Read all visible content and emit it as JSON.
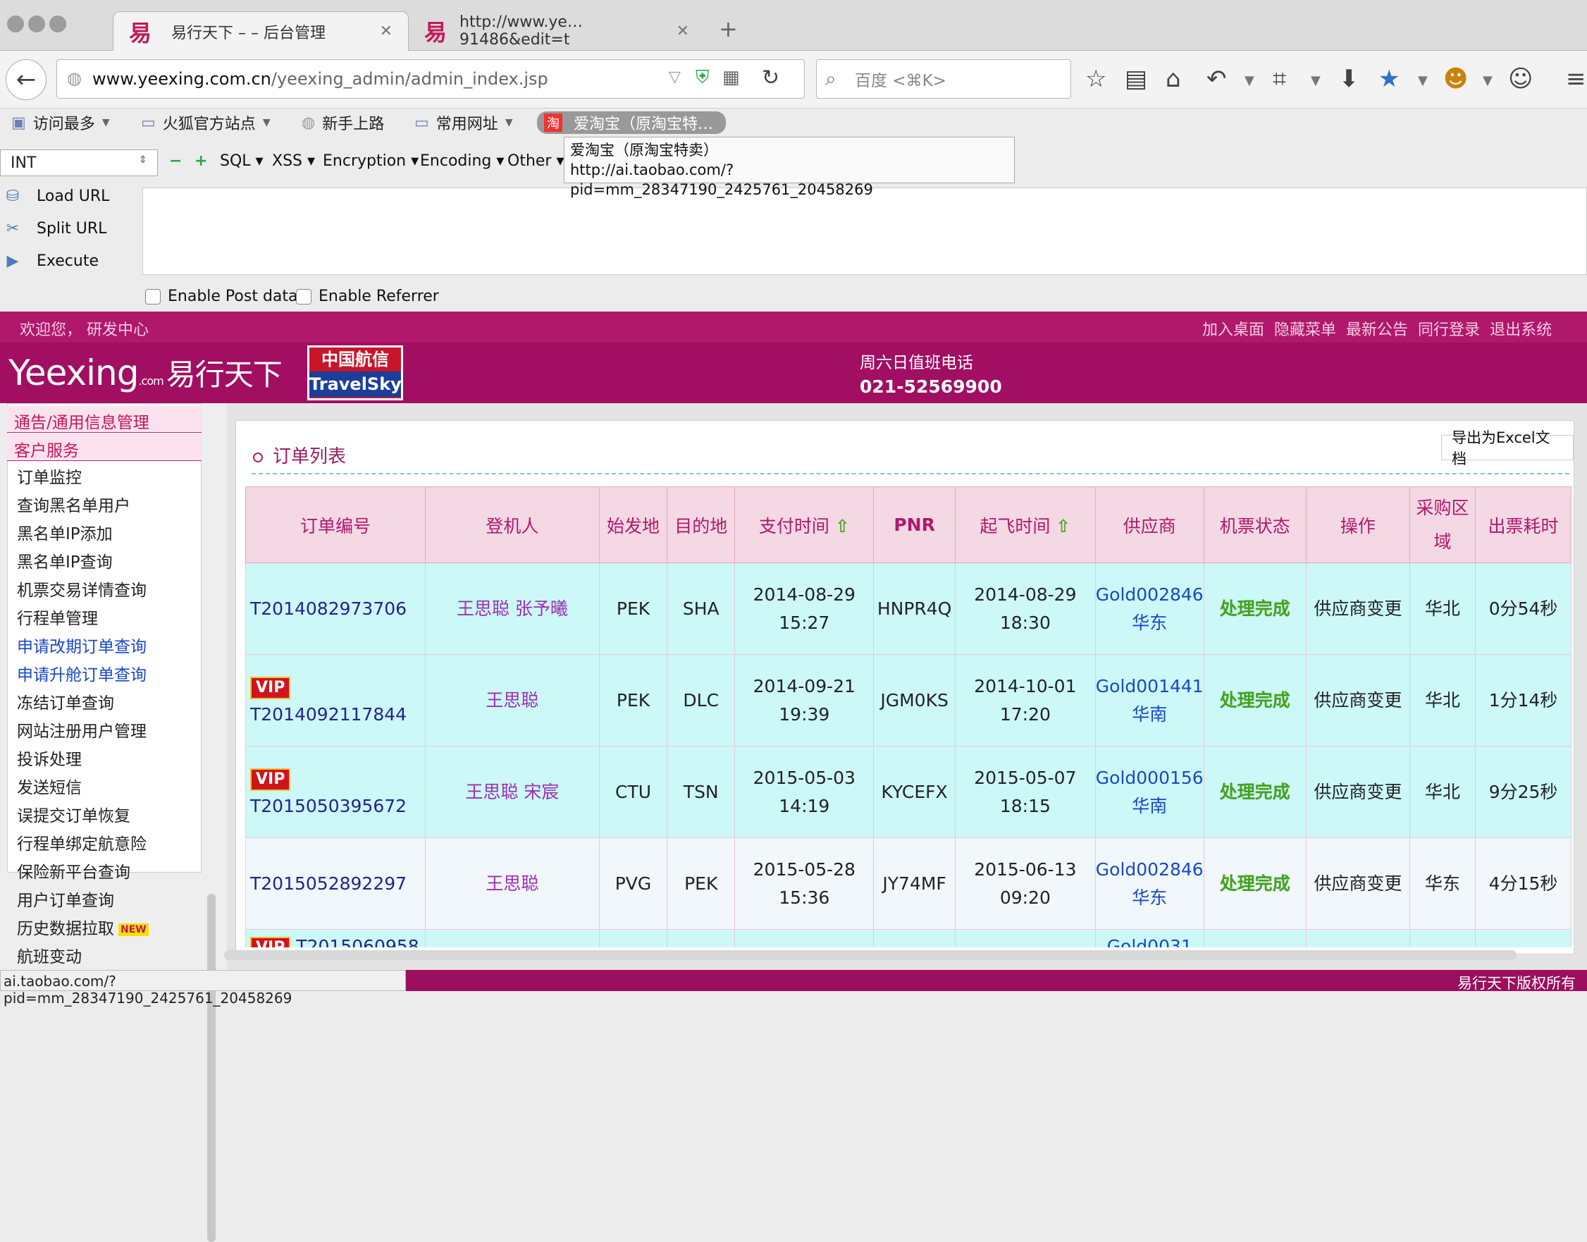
{
  "browser": {
    "tabs": [
      {
        "icon": "易",
        "title": "易行天下 – – 后台管理"
      },
      {
        "icon": "易",
        "title": "http://www.ye…91486&edit=t"
      }
    ],
    "new_tab": "+",
    "url_domain": "www.yeexing.com.cn",
    "url_path": "/yeexing_admin/admin_index.jsp",
    "search_placeholder": "百度 <⌘K>",
    "bookmarks": [
      "访问最多",
      "火狐官方站点",
      "新手上路",
      "常用网址",
      "爱淘宝（原淘宝特…"
    ],
    "tooltip_title": "爱淘宝（原淘宝特卖）",
    "tooltip_url": "http://ai.taobao.com/?pid=mm_28347190_2425761_20458269",
    "status_url": "ai.taobao.com/?pid=mm_28347190_2425761_20458269"
  },
  "hackbar": {
    "select_value": "INT",
    "menus": [
      "SQL",
      "XSS",
      "Encryption",
      "Encoding",
      "Other"
    ],
    "buttons": [
      "Load URL",
      "Split URL",
      "Execute"
    ],
    "checkboxes": [
      "Enable Post data",
      "Enable Referrer"
    ]
  },
  "site": {
    "welcome": "欢迎您， 研发中心",
    "top_links": [
      "加入桌面",
      "隐藏菜单",
      "最新公告",
      "同行登录",
      "退出系统"
    ],
    "logo_en": "Yeexing",
    "logo_com": ".com",
    "logo_cn": "易行天下",
    "partner_cn": "中国航信",
    "partner_en": "TravelSky",
    "duty_label": "周六日值班电话",
    "duty_phone": "021-52569900",
    "footer": "易行天下版权所有",
    "colors": {
      "brand": "#a10e62",
      "status_ok": "#3ea41e",
      "supplier": "#1a47c8"
    }
  },
  "sidebar": {
    "headers": [
      "通告/通用信息管理",
      "客户服务"
    ],
    "items": [
      {
        "label": "订单监控",
        "blue": false
      },
      {
        "label": "查询黑名单用户",
        "blue": false
      },
      {
        "label": "黑名单IP添加",
        "blue": false
      },
      {
        "label": "黑名单IP查询",
        "blue": false
      },
      {
        "label": "机票交易详情查询",
        "blue": false
      },
      {
        "label": "行程单管理",
        "blue": false
      },
      {
        "label": "申请改期订单查询",
        "blue": true
      },
      {
        "label": "申请升舱订单查询",
        "blue": true
      },
      {
        "label": "冻结订单查询",
        "blue": false
      },
      {
        "label": "网站注册用户管理",
        "blue": false
      },
      {
        "label": "投诉处理",
        "blue": false
      },
      {
        "label": "发送短信",
        "blue": false
      },
      {
        "label": "误提交订单恢复",
        "blue": false
      },
      {
        "label": "行程单绑定航意险",
        "blue": false
      },
      {
        "label": "保险新平台查询",
        "blue": false
      },
      {
        "label": "用户订单查询",
        "blue": false
      },
      {
        "label": "历史数据拉取",
        "blue": false,
        "badge": "NEW"
      },
      {
        "label": "航班变动",
        "blue": false
      }
    ]
  },
  "orders": {
    "title": "订单列表",
    "export_label": "导出为Excel文档",
    "columns": [
      "订单编号",
      "登机人",
      "始发地",
      "目的地",
      "支付时间",
      "PNR",
      "起飞时间",
      "供应商",
      "机票状态",
      "操作",
      "采购区域",
      "出票耗时"
    ],
    "vip_label": "VIP",
    "rows": [
      {
        "vip": false,
        "id": "T2014082973706",
        "pax": "王思聪 张予曦",
        "from": "PEK",
        "to": "SHA",
        "pay": "2014-08-29 15:27",
        "pnr": "HNPR4Q",
        "dep": "2014-08-29 18:30",
        "sup": "Gold002846",
        "sup_region": "华东",
        "status": "处理完成",
        "op": "供应商变更",
        "region": "华北",
        "elapsed": "0分54秒"
      },
      {
        "vip": true,
        "id": "T2014092117844",
        "pax": "王思聪",
        "from": "PEK",
        "to": "DLC",
        "pay": "2014-09-21 19:39",
        "pnr": "JGM0KS",
        "dep": "2014-10-01 17:20",
        "sup": "Gold001441",
        "sup_region": "华南",
        "status": "处理完成",
        "op": "供应商变更",
        "region": "华北",
        "elapsed": "1分14秒"
      },
      {
        "vip": true,
        "id": "T2015050395672",
        "pax": "王思聪 宋宸",
        "from": "CTU",
        "to": "TSN",
        "pay": "2015-05-03 14:19",
        "pnr": "KYCEFX",
        "dep": "2015-05-07 18:15",
        "sup": "Gold000156",
        "sup_region": "华南",
        "status": "处理完成",
        "op": "供应商变更",
        "region": "华北",
        "elapsed": "9分25秒"
      },
      {
        "vip": false,
        "id": "T2015052892297",
        "pax": "王思聪",
        "from": "PVG",
        "to": "PEK",
        "pay": "2015-05-28 15:36",
        "pnr": "JY74MF",
        "dep": "2015-06-13 09:20",
        "sup": "Gold002846",
        "sup_region": "华东",
        "status": "处理完成",
        "op": "供应商变更",
        "region": "华东",
        "elapsed": "4分15秒"
      },
      {
        "vip": true,
        "id": "T2015060958",
        "pax": "",
        "from": "",
        "to": "",
        "pay": "",
        "pnr": "",
        "dep": "",
        "sup": "Gold0031",
        "sup_region": "",
        "status": "",
        "op": "",
        "region": "",
        "elapsed": ""
      }
    ]
  }
}
